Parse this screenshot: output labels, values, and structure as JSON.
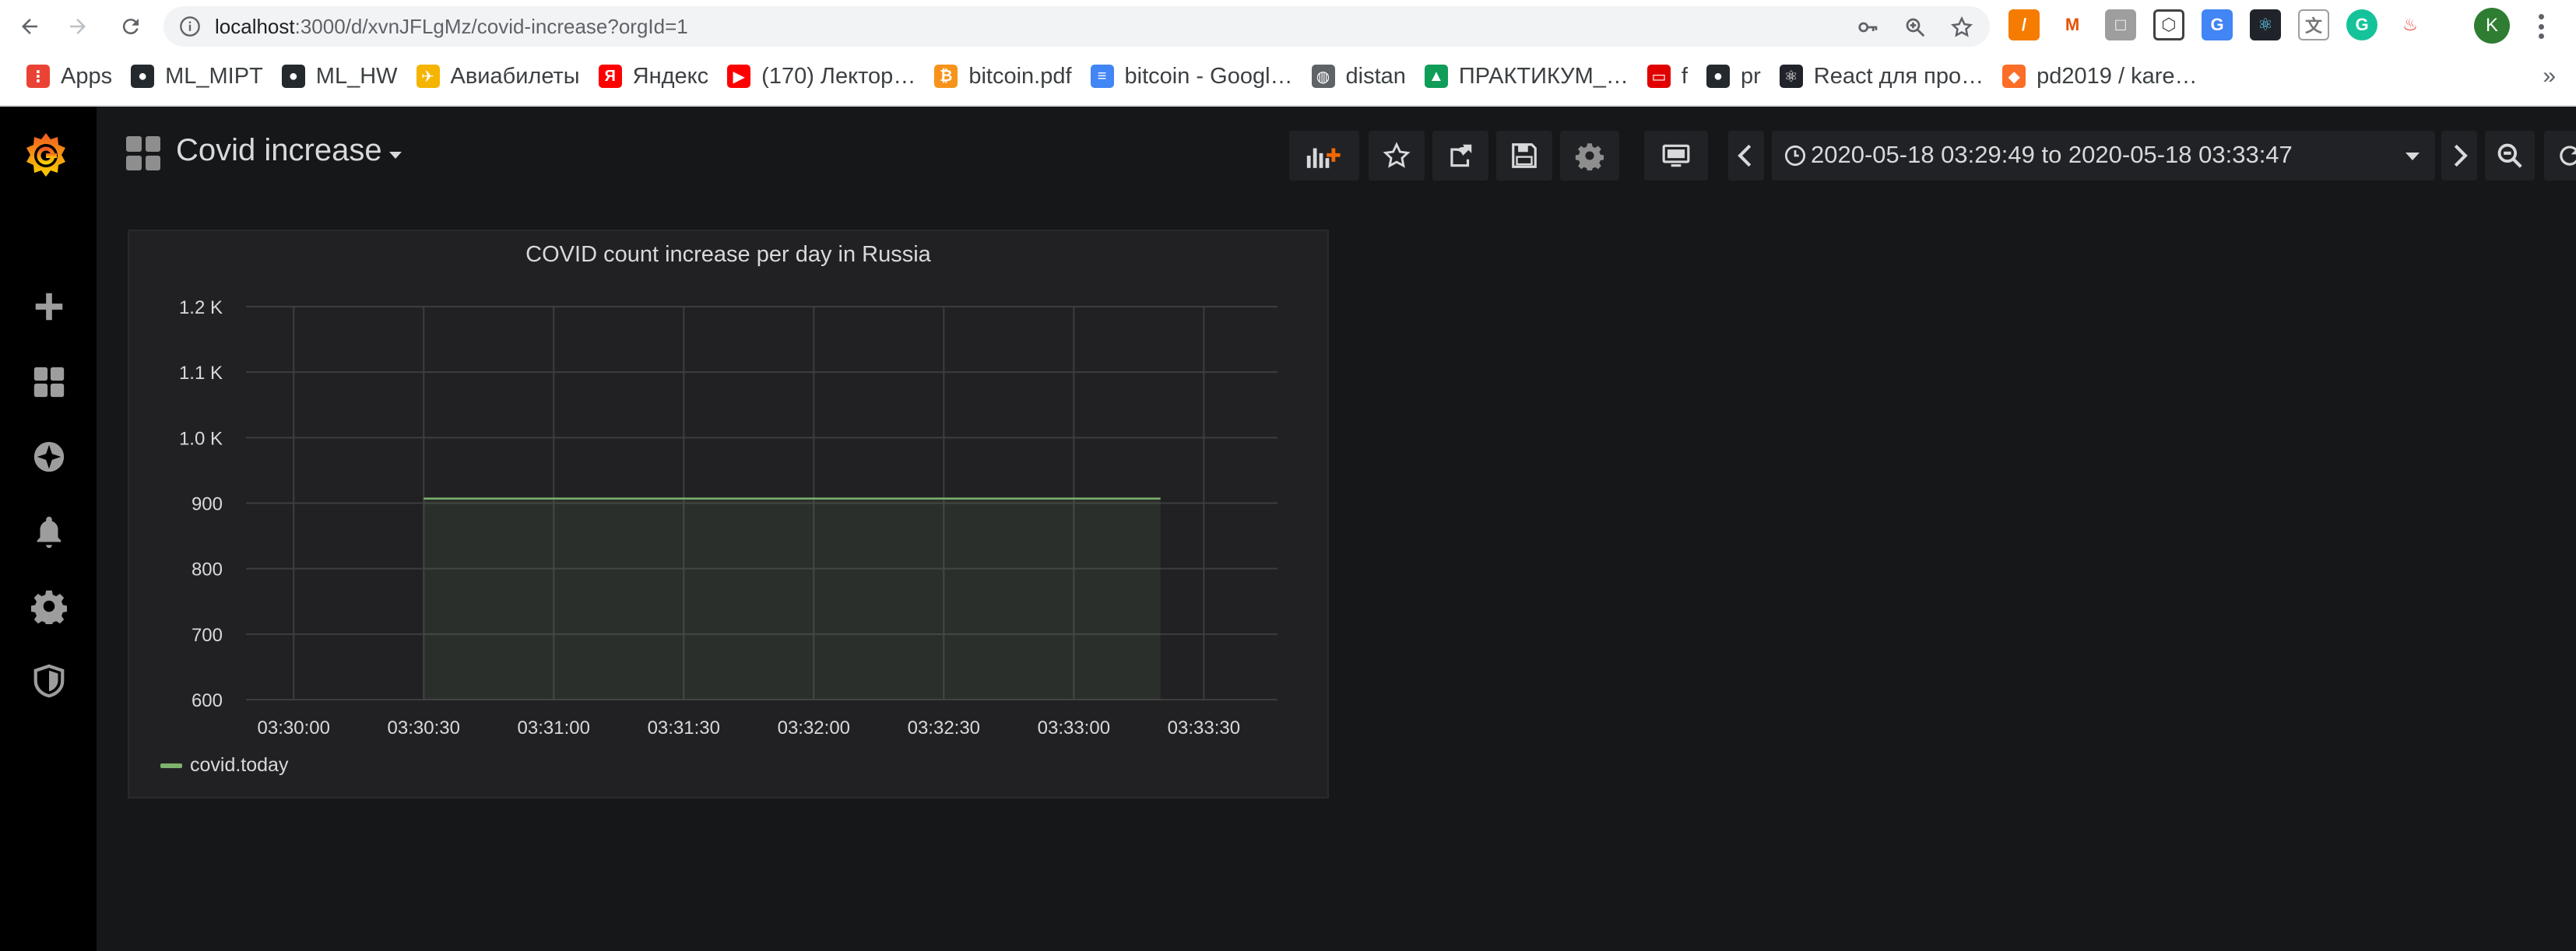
{
  "browser": {
    "url_host": "localhost",
    "url_rest": ":3000/d/xvnJFLgMz/covid-increase?orgId=1",
    "bookmarks": [
      {
        "label": "Apps",
        "icon": "apps-grid-icon",
        "color": "#ea4335"
      },
      {
        "label": "ML_MIPT",
        "icon": "github-icon",
        "color": "#24292e"
      },
      {
        "label": "ML_HW",
        "icon": "github-icon",
        "color": "#24292e"
      },
      {
        "label": "Авиабилеты",
        "icon": "airplane-icon",
        "color": "#f4b400"
      },
      {
        "label": "Яндекс",
        "icon": "yandex-icon",
        "color": "#ff0000"
      },
      {
        "label": "(170) Лектор…",
        "icon": "youtube-icon",
        "color": "#ff0000"
      },
      {
        "label": "bitcoin.pdf",
        "icon": "bitcoin-icon",
        "color": "#f7931a"
      },
      {
        "label": "bitcoin - Googl…",
        "icon": "google-docs-icon",
        "color": "#4285f4"
      },
      {
        "label": "distan",
        "icon": "globe-icon",
        "color": "#5f6368"
      },
      {
        "label": "ПРАКТИКУМ_…",
        "icon": "google-drive-icon",
        "color": "#0f9d58"
      },
      {
        "label": "f",
        "icon": "oracle-icon",
        "color": "#e00000"
      },
      {
        "label": "pr",
        "icon": "github-icon",
        "color": "#24292e"
      },
      {
        "label": "React для про…",
        "icon": "react-icon",
        "color": "#20232a"
      },
      {
        "label": "pd2019 / kare…",
        "icon": "gitlab-icon",
        "color": "#fc6d26"
      }
    ],
    "more_label": "»",
    "profile_letter": "K"
  },
  "dashboard": {
    "title": "Covid increase",
    "time_range": "2020-05-18 03:29:49 to 2020-05-18 03:33:47"
  },
  "panel": {
    "title": "COVID count increase per day in Russia",
    "legend": "covid.today"
  },
  "colors": {
    "series": "#7eb26d",
    "grafana_orange": "#f46800",
    "background": "#161719",
    "panel": "#212124"
  },
  "chart_data": {
    "type": "area",
    "title": "COVID count increase per day in Russia",
    "xlabel": "",
    "ylabel": "",
    "x_ticks": [
      "03:30:00",
      "03:30:30",
      "03:31:00",
      "03:31:30",
      "03:32:00",
      "03:32:30",
      "03:33:00",
      "03:33:30"
    ],
    "y_ticks": [
      "600",
      "700",
      "800",
      "900",
      "1.0 K",
      "1.1 K",
      "1.2 K"
    ],
    "ylim": [
      600,
      1200
    ],
    "xlim": [
      "03:29:49",
      "03:33:47"
    ],
    "grid": true,
    "legend_position": "bottom-left",
    "series": [
      {
        "name": "covid.today",
        "color": "#7eb26d",
        "x": [
          "03:30:30",
          "03:33:20"
        ],
        "values": [
          907,
          907
        ]
      }
    ]
  }
}
